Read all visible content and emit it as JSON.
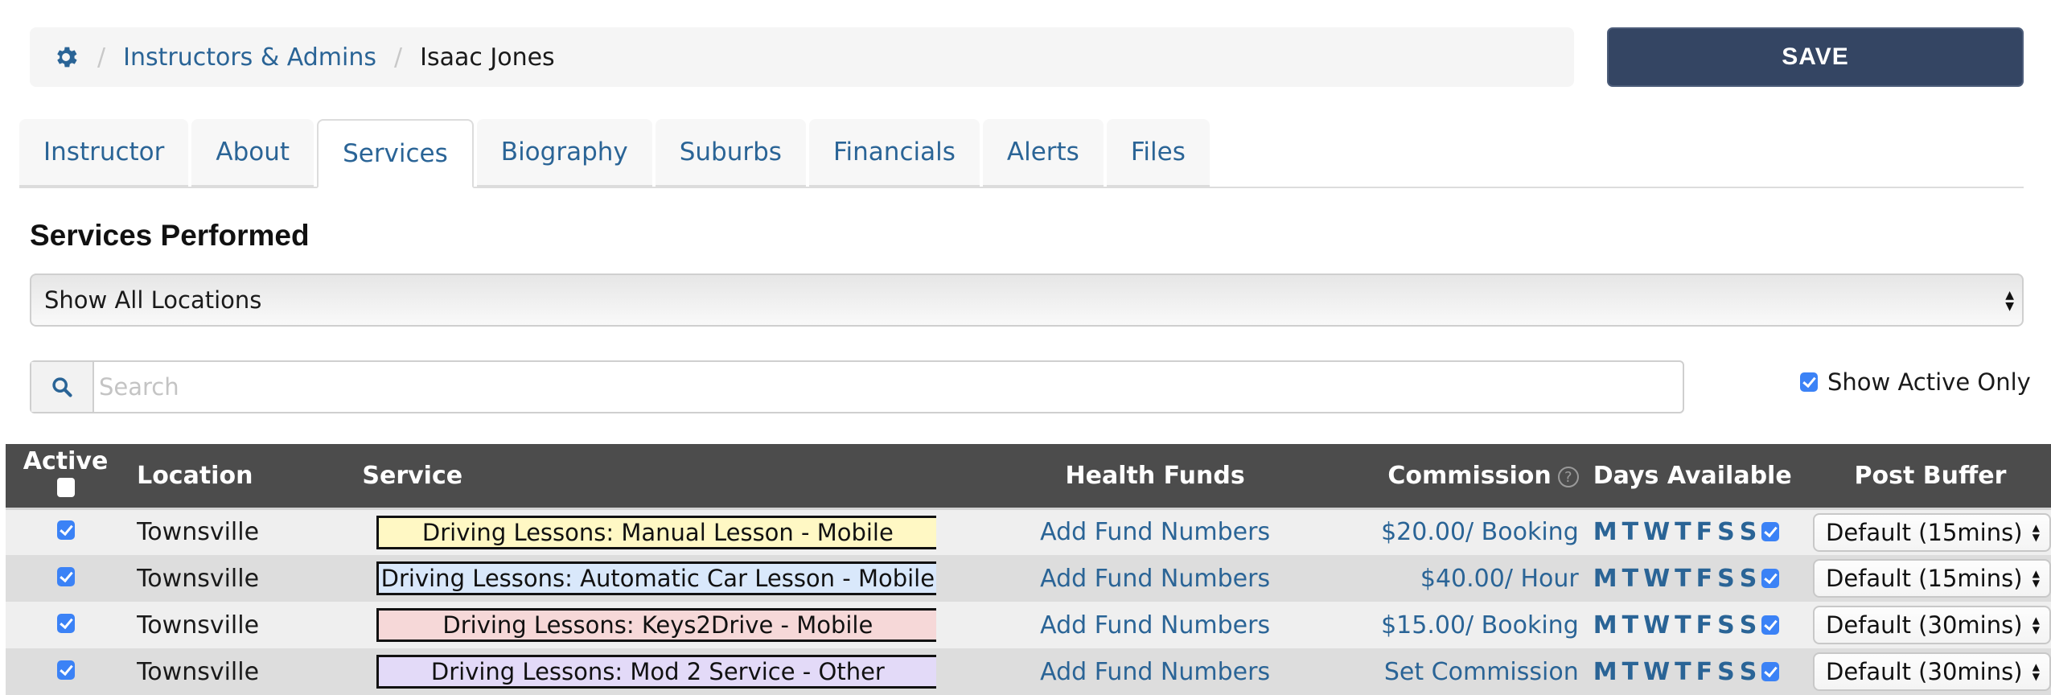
{
  "breadcrumb": {
    "icon": "gear-icon",
    "items": [
      {
        "label": "Instructors & Admins"
      },
      {
        "label": "Isaac Jones"
      }
    ],
    "separator": "/"
  },
  "toolbar": {
    "save_label": "SAVE"
  },
  "tabs": [
    {
      "label": "Instructor"
    },
    {
      "label": "About"
    },
    {
      "label": "Services",
      "active": true
    },
    {
      "label": "Biography"
    },
    {
      "label": "Suburbs"
    },
    {
      "label": "Financials"
    },
    {
      "label": "Alerts"
    },
    {
      "label": "Files"
    }
  ],
  "section": {
    "title": "Services Performed"
  },
  "location_filter": {
    "selected": "Show All Locations"
  },
  "search": {
    "placeholder": "Search",
    "value": ""
  },
  "show_active_only": {
    "label": "Show Active Only",
    "checked": true
  },
  "table": {
    "headers": {
      "active": "Active",
      "location": "Location",
      "service": "Service",
      "health_funds": "Health Funds",
      "commission": "Commission",
      "days": "Days Available",
      "buffer": "Post Buffer"
    },
    "header_active_checked": false,
    "day_letters": [
      "M",
      "T",
      "W",
      "T",
      "F",
      "S",
      "S"
    ],
    "rows": [
      {
        "active": true,
        "location": "Townsville",
        "service": "Driving Lessons: Manual Lesson - Mobile",
        "service_color": "#FFF8C4",
        "health_funds": "Add Fund Numbers",
        "commission": "$20.00/ Booking",
        "all_days": true,
        "buffer": "Default (15mins)"
      },
      {
        "active": true,
        "location": "Townsville",
        "service": "Driving Lessons: Automatic Car Lesson - Mobile",
        "service_color": "#D9E8FB",
        "health_funds": "Add Fund Numbers",
        "commission": "$40.00/ Hour",
        "all_days": true,
        "buffer": "Default (15mins)"
      },
      {
        "active": true,
        "location": "Townsville",
        "service": "Driving Lessons: Keys2Drive - Mobile",
        "service_color": "#F6D8D8",
        "health_funds": "Add Fund Numbers",
        "commission": "$15.00/ Booking",
        "all_days": true,
        "buffer": "Default (30mins)"
      },
      {
        "active": true,
        "location": "Townsville",
        "service": "Driving Lessons: Mod 2 Service - Other",
        "service_color": "#E3DAF8",
        "health_funds": "Add Fund Numbers",
        "commission": "Set Commission",
        "all_days": true,
        "buffer": "Default (30mins)"
      }
    ]
  },
  "colors": {
    "link": "#2a6496",
    "save_button": "#344563",
    "table_header": "#4c4c4c",
    "checkbox": "#3b82f6"
  }
}
